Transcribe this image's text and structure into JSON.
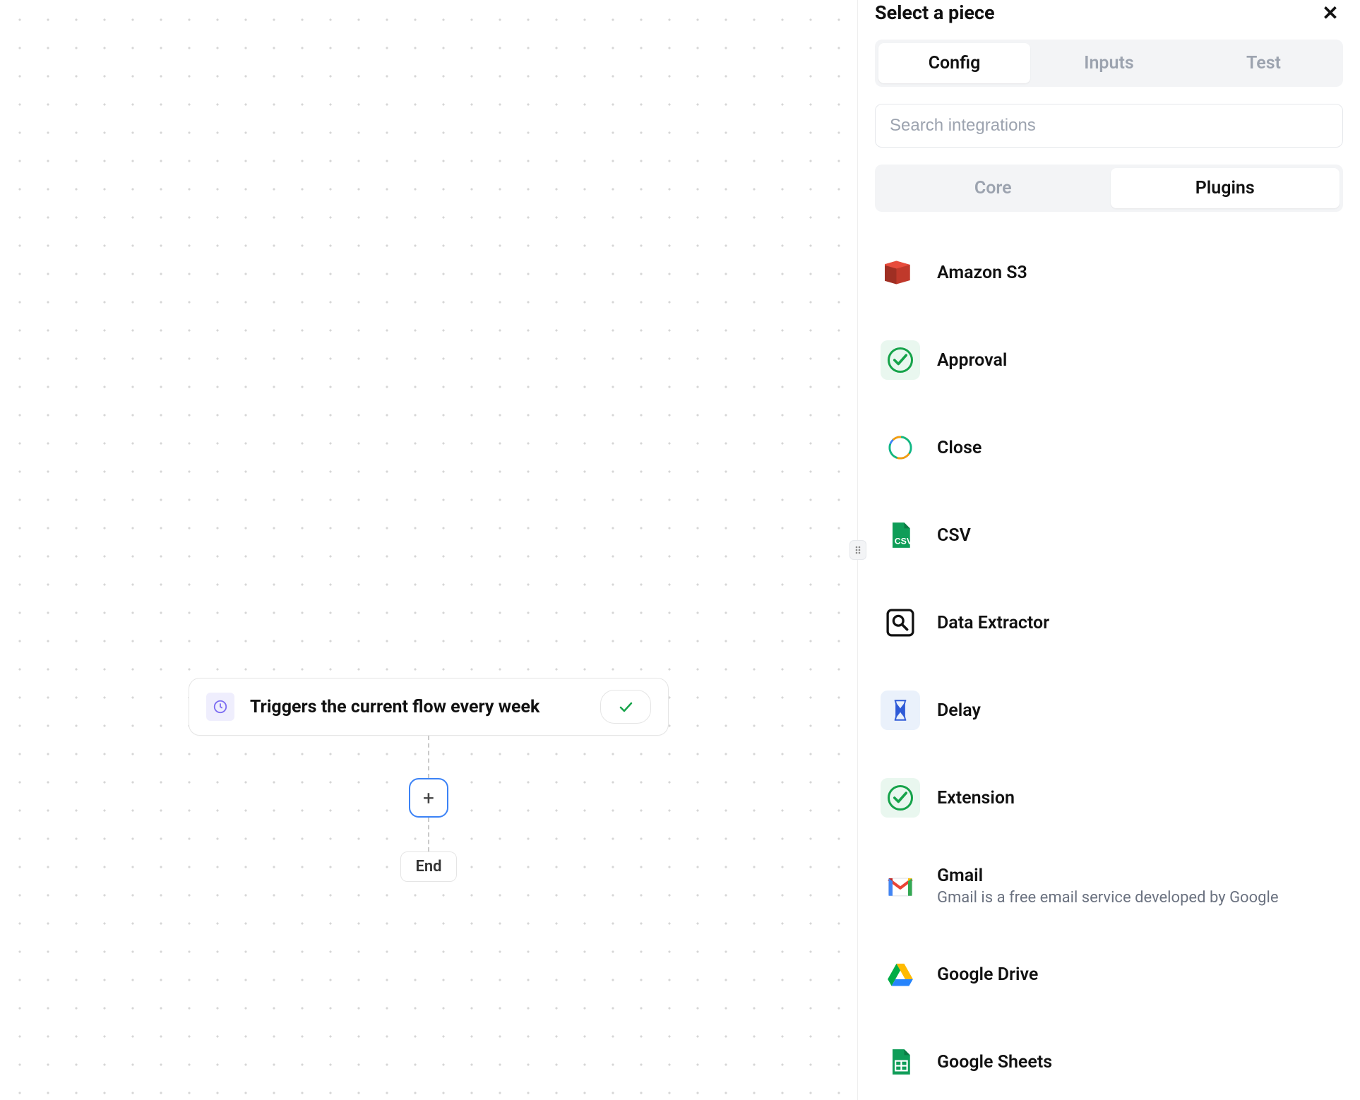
{
  "canvas": {
    "trigger_label": "Triggers the current flow every week",
    "add_label": "+",
    "end_label": "End"
  },
  "panel": {
    "title": "Select a piece",
    "tabs": {
      "config": "Config",
      "inputs": "Inputs",
      "test": "Test",
      "active": "config"
    },
    "search_placeholder": "Search integrations",
    "categories": {
      "core": "Core",
      "plugins": "Plugins",
      "active": "plugins"
    },
    "plugins": [
      {
        "id": "amazon-s3",
        "name": "Amazon S3",
        "icon": "s3",
        "bg": ""
      },
      {
        "id": "approval",
        "name": "Approval",
        "icon": "check",
        "bg": "ico-green-bg"
      },
      {
        "id": "close",
        "name": "Close",
        "icon": "close-crm",
        "bg": ""
      },
      {
        "id": "csv",
        "name": "CSV",
        "icon": "csv",
        "bg": ""
      },
      {
        "id": "data-extractor",
        "name": "Data Extractor",
        "icon": "magnify",
        "bg": ""
      },
      {
        "id": "delay",
        "name": "Delay",
        "icon": "hourglass",
        "bg": "ico-blue-bg"
      },
      {
        "id": "extension",
        "name": "Extension",
        "icon": "check",
        "bg": "ico-green-bg"
      },
      {
        "id": "gmail",
        "name": "Gmail",
        "icon": "gmail",
        "bg": "",
        "desc": "Gmail is a free email service developed by Google"
      },
      {
        "id": "google-drive",
        "name": "Google Drive",
        "icon": "gdrive",
        "bg": ""
      },
      {
        "id": "google-sheets",
        "name": "Google Sheets",
        "icon": "gsheets",
        "bg": ""
      }
    ]
  },
  "icons": {
    "schedule": "clock",
    "close_glyph": "✕"
  }
}
